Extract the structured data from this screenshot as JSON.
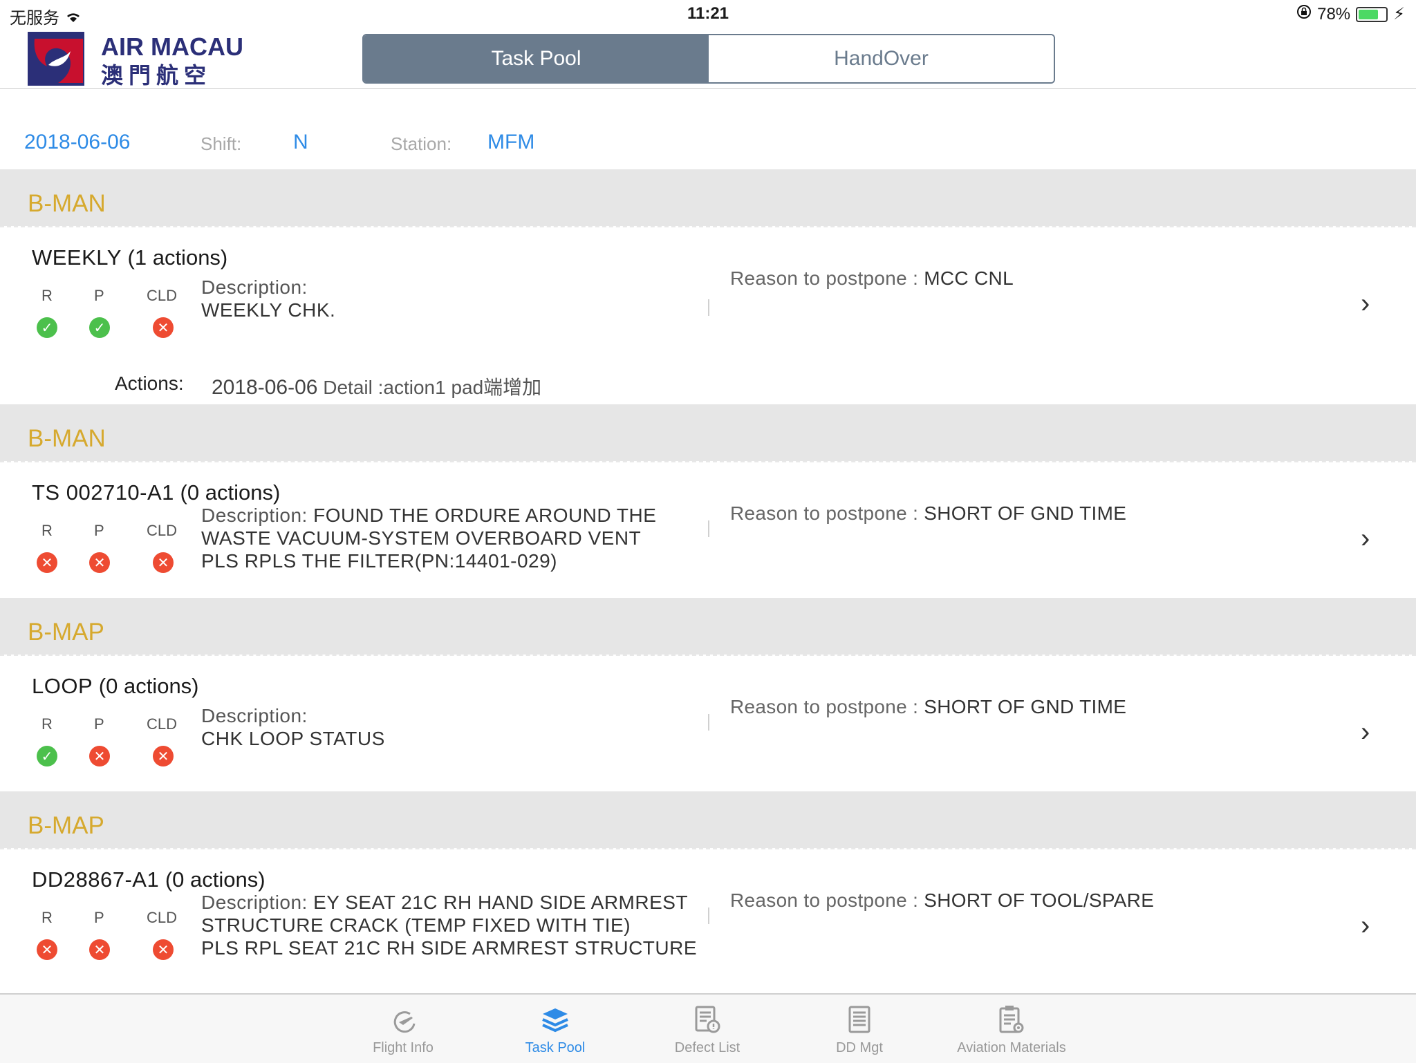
{
  "status_bar": {
    "carrier": "无服务",
    "time": "11:21",
    "battery": "78%",
    "battery_level": 0.78
  },
  "brand": {
    "name_en": "AIR MACAU",
    "name_zh": "澳門航空"
  },
  "segments": [
    {
      "label": "Task Pool",
      "selected": true
    },
    {
      "label": "HandOver",
      "selected": false
    }
  ],
  "filter": {
    "date": "2018-06-06",
    "shift_label": "Shift:",
    "shift_value": "N",
    "station_label": "Station:",
    "station_value": "MFM"
  },
  "labels": {
    "r": "R",
    "p": "P",
    "cld": "CLD",
    "description": "Description:",
    "reason": "Reason to postpone : ",
    "actions": "Actions:"
  },
  "items": [
    {
      "aircraft": "B-MAN",
      "task": "WEEKLY",
      "count": "(1 actions)",
      "r": "ok",
      "p": "ok",
      "cld": "no",
      "desc_lines": [
        "WEEKLY CHK."
      ],
      "reason": "MCC CNL",
      "action_date": "2018-06-06",
      "action_detail": "Detail :action1  pad端增加"
    },
    {
      "aircraft": "B-MAN",
      "task": "TS  002710-A1",
      "count": "(0 actions)",
      "r": "no",
      "p": "no",
      "cld": "no",
      "desc_inline": "FOUND THE ORDURE AROUND THE",
      "desc_lines": [
        "WASTE VACUUM-SYSTEM OVERBOARD VENT",
        "PLS RPLS THE FILTER(PN:14401-029)"
      ],
      "reason": "SHORT OF GND TIME"
    },
    {
      "aircraft": "B-MAP",
      "task": "LOOP",
      "count": "(0 actions)",
      "r": "ok",
      "p": "no",
      "cld": "no",
      "desc_lines": [
        "CHK LOOP STATUS"
      ],
      "reason": "SHORT OF GND TIME"
    },
    {
      "aircraft": "B-MAP",
      "task": "DD28867-A1",
      "count": "(0 actions)",
      "r": "no",
      "p": "no",
      "cld": "no",
      "desc_inline": "EY SEAT 21C RH HAND SIDE ARMREST",
      "desc_lines": [
        "STRUCTURE CRACK (TEMP FIXED WITH TIE)",
        "PLS RPL SEAT 21C RH SIDE ARMREST STRUCTURE"
      ],
      "reason": "SHORT OF TOOL/SPARE"
    }
  ],
  "tabs": [
    {
      "label": "Flight Info",
      "icon": "flight-icon",
      "active": false
    },
    {
      "label": "Task Pool",
      "icon": "layers-icon",
      "active": true
    },
    {
      "label": "Defect List",
      "icon": "defect-list-icon",
      "active": false
    },
    {
      "label": "DD Mgt",
      "icon": "document-icon",
      "active": false
    },
    {
      "label": "Aviation Materials",
      "icon": "clipboard-gear-icon",
      "active": false
    }
  ],
  "colors": {
    "accent_blue": "#2e8be6",
    "segment_active": "#6a7b8d",
    "section_title": "#d6a92e",
    "ok": "#4cc04c",
    "error": "#ee4b32"
  }
}
